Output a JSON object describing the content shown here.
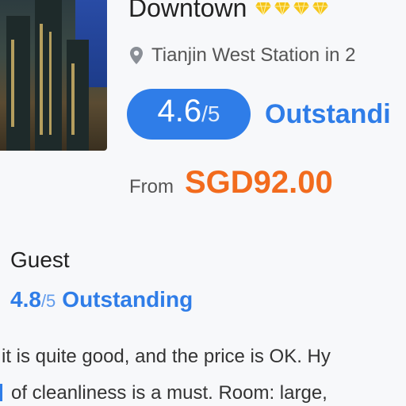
{
  "hotel": {
    "name": "Downtown",
    "diamond_icon": "diamond-icon",
    "diamond_color": "#f5c518",
    "location": "Tianjin West Station in 2",
    "location_icon": "map-pin-icon"
  },
  "rating": {
    "score": "4.6",
    "scale": "/5",
    "label": "Outstandi"
  },
  "price": {
    "from_label": "From",
    "amount": "SGD92.00"
  },
  "guest": {
    "title": "Guest",
    "score": "4.8",
    "scale": "/5",
    "label": "Outstanding",
    "review_line_1": "it is quite good, and the price is OK. Hy",
    "review_line_2": "of cleanliness is a must. Room: large,"
  },
  "colors": {
    "accent": "#2f7de8",
    "price": "#f26b1d",
    "diamond": "#f5c518"
  }
}
